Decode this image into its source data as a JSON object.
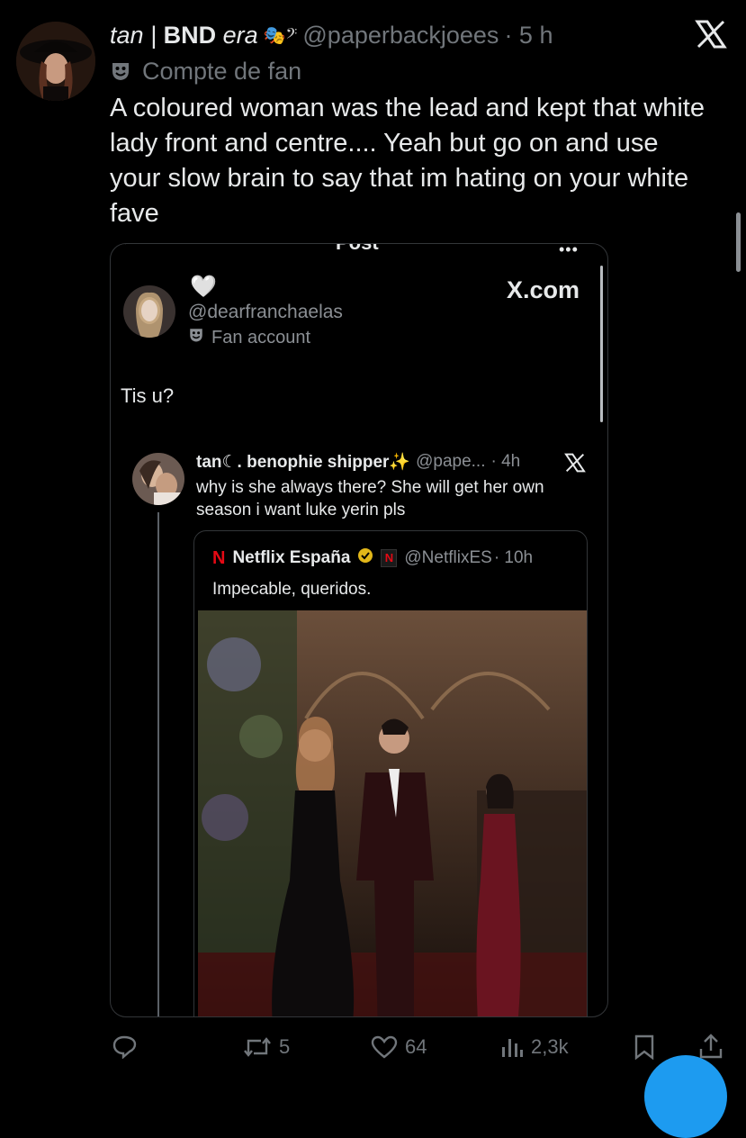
{
  "tweet": {
    "name_prefix": "tan |",
    "name_bold": "BND",
    "name_suffix": "era",
    "name_emoji": "🎭𝄢",
    "handle": "@paperbackjoees",
    "time": "· 5 h",
    "badge": "Compte de fan",
    "text": "A coloured woman was the lead and kept that white lady front and centre.... Yeah but go on and use your slow brain to say that im hating on your white fave"
  },
  "embedded": {
    "top_title": "Post",
    "heart": "🤍",
    "handle": "@dearfranchaelas",
    "badge": "Fan account",
    "xcom": "X.com",
    "text": "Tis u?",
    "quote": {
      "name": "tan☾. benophie shipper✨",
      "handle": "@pape...",
      "time": "· 4h",
      "text": "why is she always there? She will get her own season i want luke yerin pls",
      "inner": {
        "name": "Netflix España",
        "handle": "@NetflixES",
        "time": "· 10h",
        "text": "Impecable, queridos."
      }
    }
  },
  "actions": {
    "retweets": "5",
    "likes": "64",
    "views": "2,3k"
  },
  "colors": {
    "background": "#000000",
    "text": "#e7e9ea",
    "muted": "#71767b",
    "netflix_red": "#e50914",
    "verified": "#e2b719",
    "fab": "#1d9bf0"
  }
}
